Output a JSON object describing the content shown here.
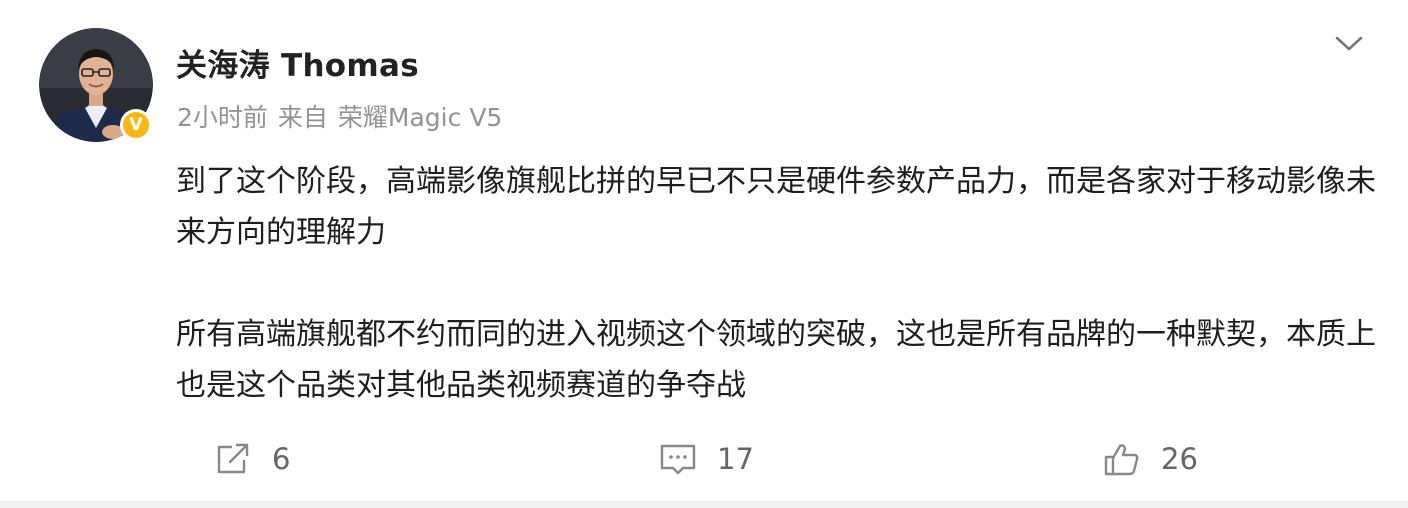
{
  "post": {
    "username": "关海涛 Thomas",
    "timestamp": "2小时前",
    "source_prefix": "来自",
    "source_device": "荣耀Magic V5",
    "verified_badge": "V",
    "paragraph1": "到了这个阶段，高端影像旗舰比拼的早已不只是硬件参数产品力，而是各家对于移动影像未来方向的理解力",
    "paragraph2": "所有高端旗舰都不约而同的进入视频这个领域的突破，这也是所有品牌的一种默契，本质上也是这个品类对其他品类视频赛道的争夺战"
  },
  "actions": {
    "repost_count": "6",
    "comment_count": "17",
    "like_count": "26"
  },
  "icons": {
    "menu": "chevron-down-icon",
    "repost": "share-icon",
    "comment": "comment-icon",
    "like": "thumbs-up-icon",
    "verified": "verified-badge-icon"
  },
  "colors": {
    "name": "#222222",
    "meta": "#939393",
    "body_text": "#1e1e1e",
    "badge": "#f8b713",
    "action_icon": "#888888"
  }
}
